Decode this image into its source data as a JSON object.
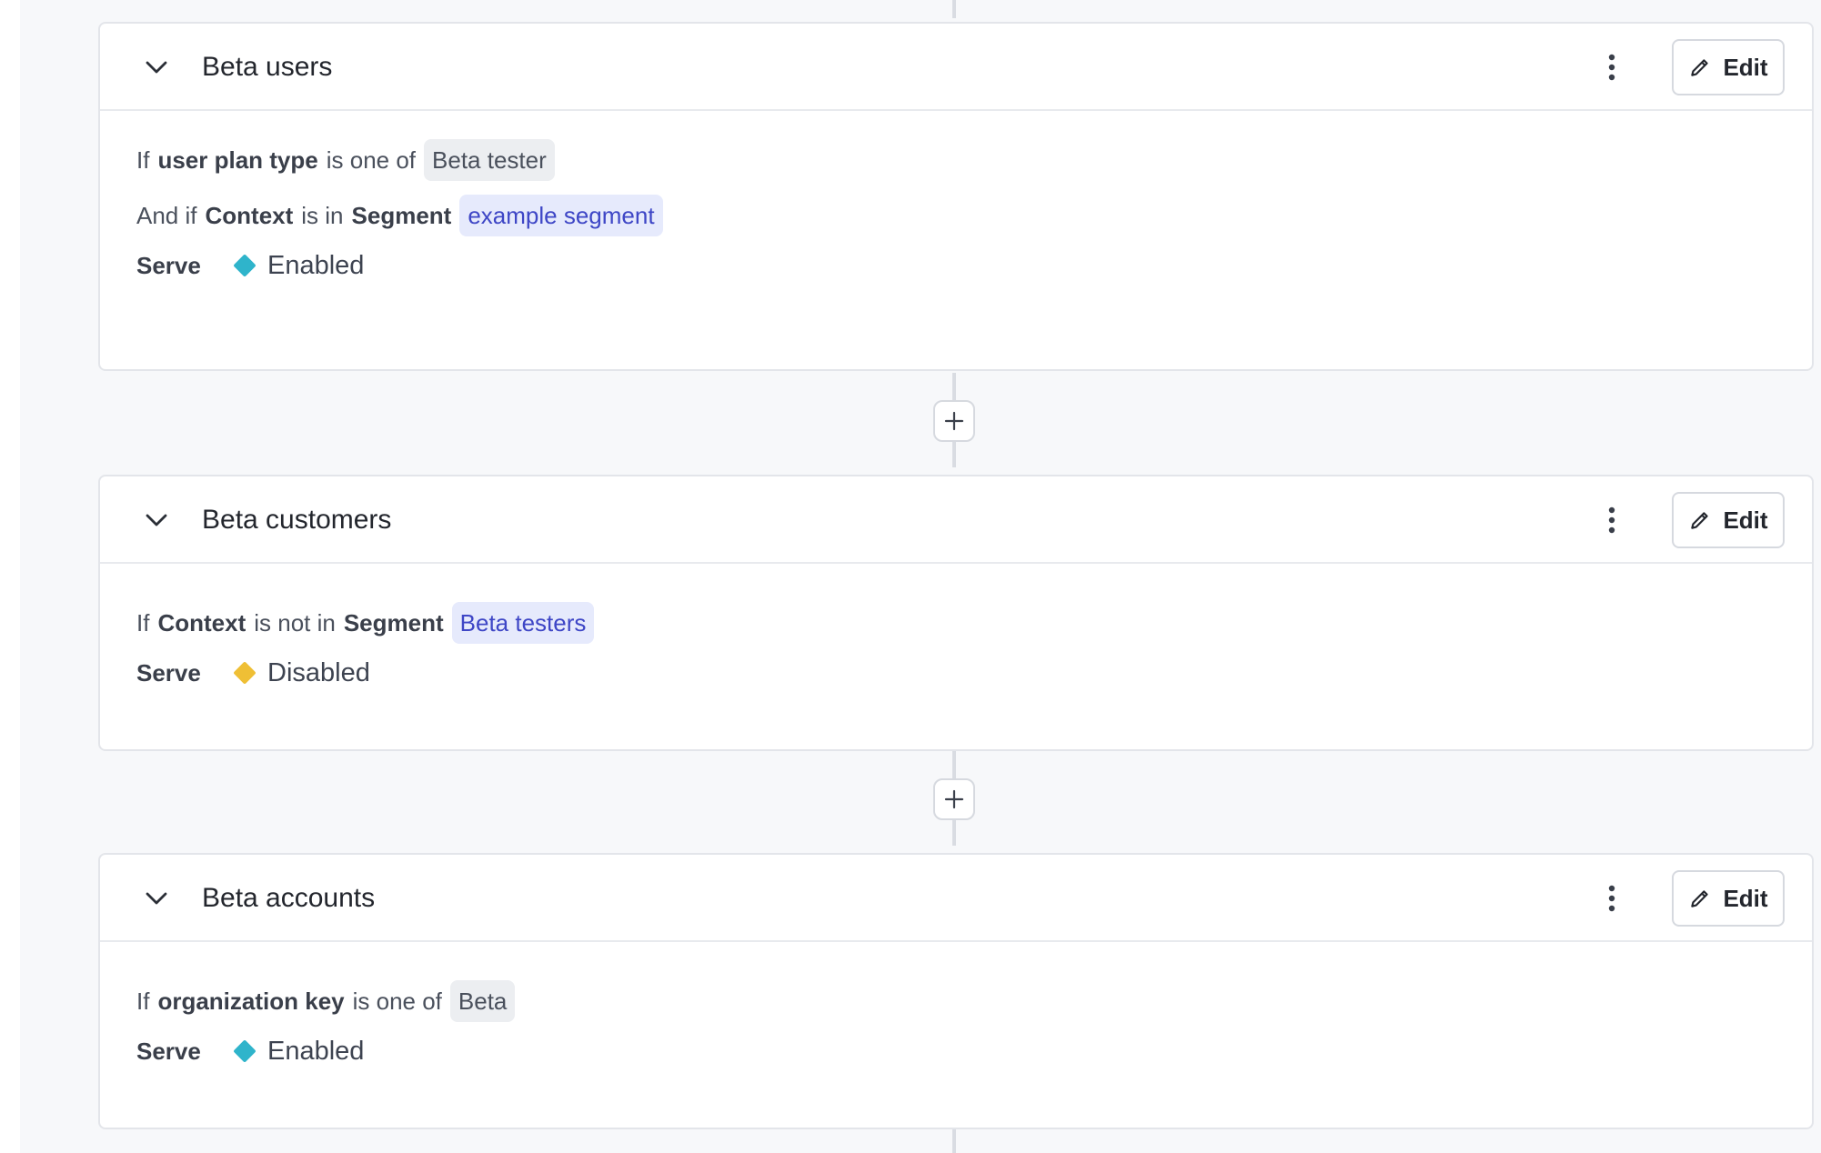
{
  "colors": {
    "enabled": "#2fb4cb",
    "disabled": "#efbf35",
    "segment_chip_text": "#3e46c6",
    "segment_chip_bg": "#e6eafc"
  },
  "rules": [
    {
      "title": "Beta users",
      "edit_label": "Edit",
      "clauses": [
        {
          "lead": "If",
          "attribute": "user plan type",
          "operator": "is one of",
          "value": "Beta tester",
          "value_kind": "value"
        },
        {
          "lead": "And if",
          "attribute": "Context",
          "operator": "is in",
          "keyword": "Segment",
          "value": "example segment",
          "value_kind": "segment"
        }
      ],
      "serve_label": "Serve",
      "serve_value": "Enabled",
      "serve_icon": "diamond-icon",
      "serve_color": "#2fb4cb"
    },
    {
      "title": "Beta customers",
      "edit_label": "Edit",
      "clauses": [
        {
          "lead": "If",
          "attribute": "Context",
          "operator": "is not in",
          "keyword": "Segment",
          "value": "Beta testers",
          "value_kind": "segment"
        }
      ],
      "serve_label": "Serve",
      "serve_value": "Disabled",
      "serve_icon": "diamond-icon",
      "serve_color": "#efbf35"
    },
    {
      "title": "Beta accounts",
      "edit_label": "Edit",
      "clauses": [
        {
          "lead": "If",
          "attribute": "organization key",
          "operator": "is one of",
          "value": "Beta",
          "value_kind": "value"
        }
      ],
      "serve_label": "Serve",
      "serve_value": "Enabled",
      "serve_icon": "diamond-icon",
      "serve_color": "#2fb4cb"
    }
  ]
}
